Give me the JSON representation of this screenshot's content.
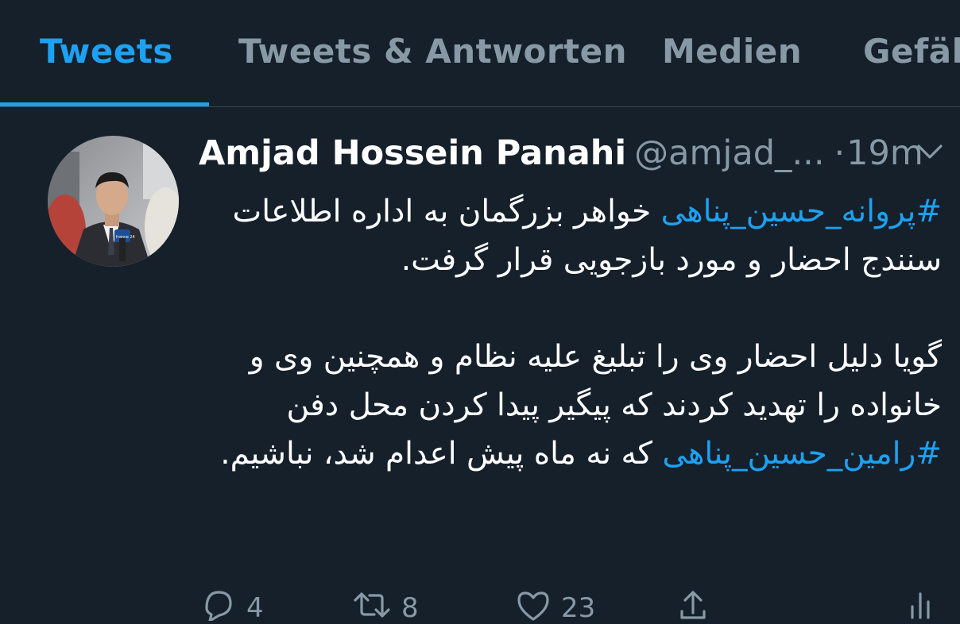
{
  "tabs": [
    {
      "label": "Tweets",
      "active": true
    },
    {
      "label": "Tweets & Antworten",
      "active": false
    },
    {
      "label": "Medien",
      "active": false
    },
    {
      "label": "Gefäl",
      "active": false
    }
  ],
  "tweet": {
    "author_name": "Amjad Hossein Panahi",
    "author_handle": "@amjad_...",
    "separator": "·",
    "time": "19m",
    "hashtag_1": "#پروانه_حسین_پناهی",
    "text_1": " خواهر بزرگمان به اداره اطلاعات سنندج احضار و مورد بازجویی قرار گرفت.",
    "text_2a": "گویا دلیل احضار وی را تبلیغ علیه نظام و همچنین وی و خانواده را تهدید کردند که پیگیر پیدا کردن محل دفن ",
    "hashtag_2": "#رامین_حسین_پناهی",
    "text_2b": " که نه ماه پیش اعدام شد، نباشیم.",
    "replies": "4",
    "retweets": "8",
    "likes": "23",
    "avatar_badge_text": "france 24"
  },
  "colors": {
    "background": "#15202b",
    "accent": "#1da1f2",
    "muted": "#8899a6",
    "divider": "#38444d"
  },
  "icons": [
    "chevron-down-icon",
    "reply-icon",
    "retweet-icon",
    "like-icon",
    "share-icon"
  ]
}
